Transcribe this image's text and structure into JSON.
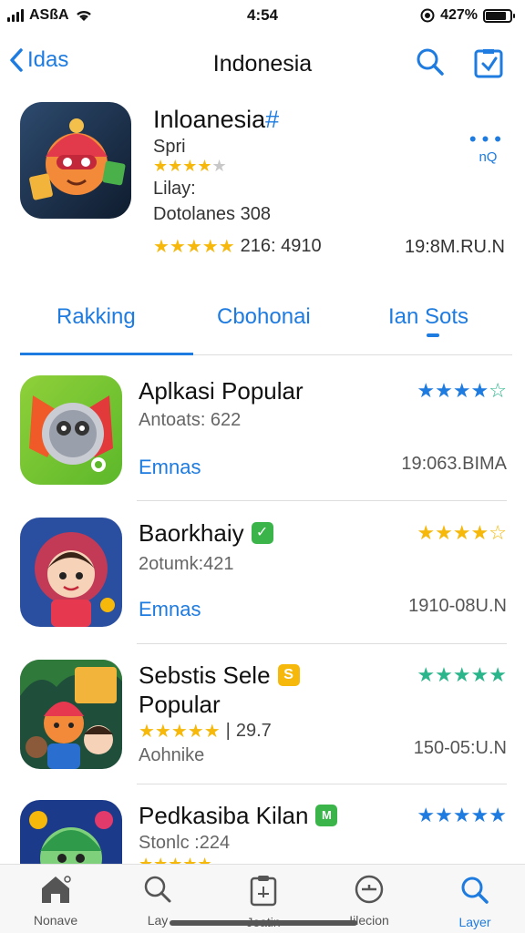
{
  "status": {
    "carrier": "ASßA",
    "time": "4:54",
    "battery_text": "427%",
    "battery_level": 0.85
  },
  "nav": {
    "back_label": "Idas",
    "title": "Indonesia"
  },
  "hero": {
    "name": "Inloanesia",
    "name_accent": "#",
    "subtitle": "Spri",
    "rating_stars": 4,
    "line3": "Lilay:",
    "line4": "Dotolanes 308",
    "rating_text": "216: 4910",
    "date": "19:8M.RU.N",
    "more_label": "nQ"
  },
  "tabs": [
    {
      "label": "Rakking"
    },
    {
      "label": "Cbohonai"
    },
    {
      "label": "Ian Sots"
    }
  ],
  "apps": [
    {
      "title": "Aplkasi Popular",
      "meta": "Antoats: 622",
      "action": "Emnas",
      "date": "19:063.BIMA",
      "stars_color": "#1e7be0"
    },
    {
      "title": "Baorkhaiy",
      "badge_color": "#3bb44a",
      "badge_glyph": "✓",
      "meta": "2otumk:421",
      "action": "Emnas",
      "date": "1910-08U.N",
      "stars_color": "#f6b80a"
    },
    {
      "title": "Sebstis Sele",
      "title2": "Popular",
      "badge_color": "#f6b80a",
      "badge_glyph": "S",
      "rating_text": "29.7",
      "meta": "Aohnike",
      "date": "150-05:U.N",
      "stars_color": "#2bb58b"
    },
    {
      "title": "Pedkasiba Kilan",
      "badge_color": "#3bb44a",
      "badge_glyph": "M",
      "meta": "Stonlc :224",
      "stars_color": "#1e7be0"
    }
  ],
  "tabbar": [
    {
      "label": "Nonave",
      "icon": "home-icon"
    },
    {
      "label": "Lay",
      "icon": "search-icon"
    },
    {
      "label": "Jeatin",
      "icon": "clipboard-icon"
    },
    {
      "label": "Iilecion",
      "icon": "plus-circle-icon"
    },
    {
      "label": "Layer",
      "icon": "search-icon",
      "active": true
    }
  ],
  "colors": {
    "accent": "#1e7be0",
    "star": "#f6b80a"
  }
}
